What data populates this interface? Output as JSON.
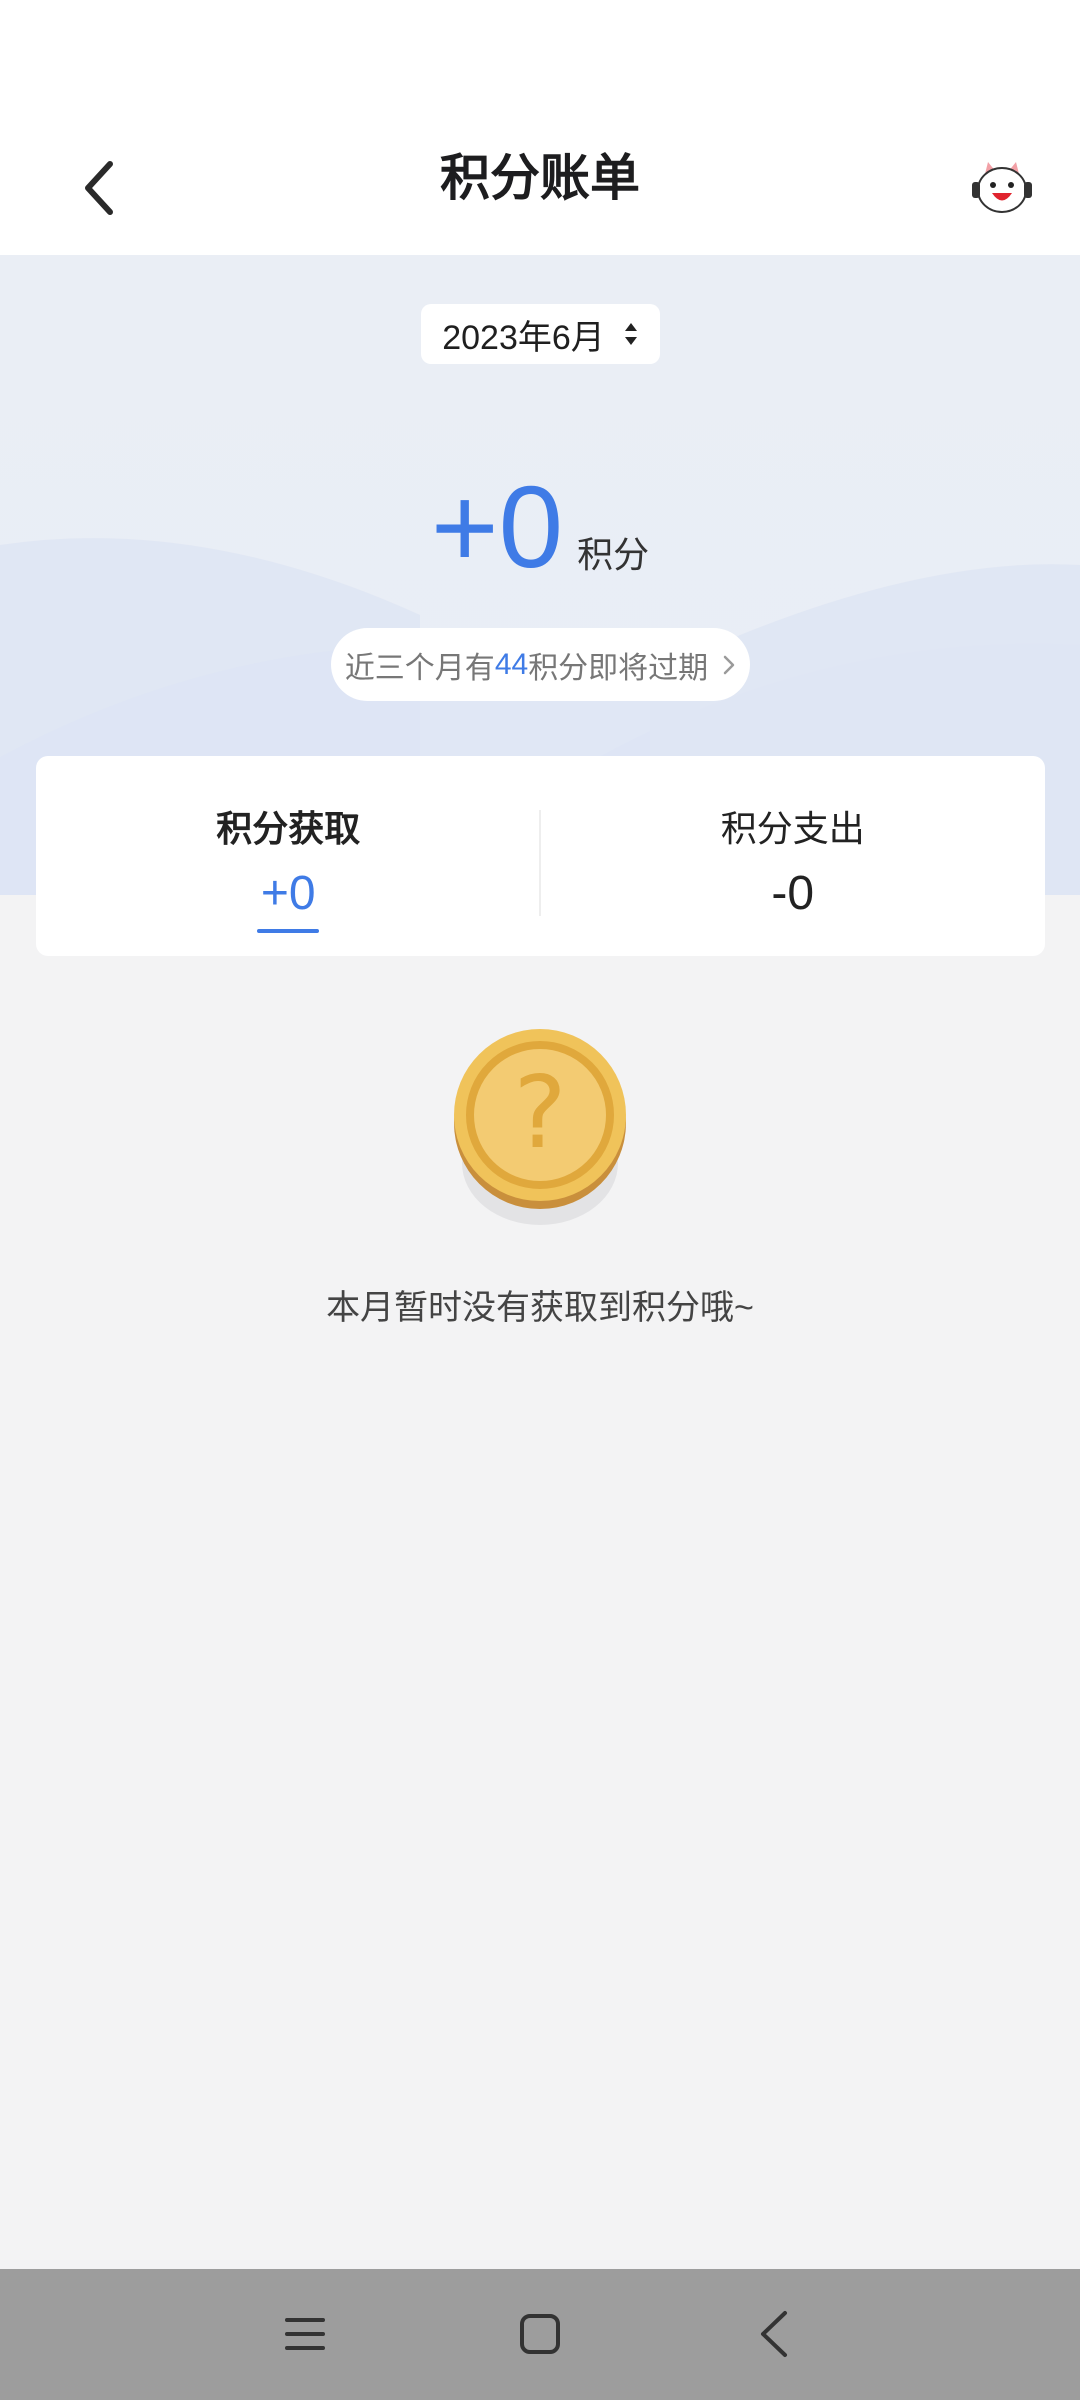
{
  "header": {
    "title": "积分账单",
    "back_icon": "chevron-left-icon",
    "mascot_icon": "mascot-avatar-icon"
  },
  "month_picker": {
    "value": "2023年6月",
    "icon": "sort-arrows-icon"
  },
  "points": {
    "value": "+0",
    "unit": "积分"
  },
  "expire_notice": {
    "prefix": "近三个月有",
    "number": "44",
    "suffix": "积分即将过期",
    "icon": "chevron-right-icon"
  },
  "summary": {
    "earned_label": "积分获取",
    "earned_value": "+0",
    "spent_label": "积分支出",
    "spent_value": "-0"
  },
  "empty_state": {
    "icon": "question-coin-icon",
    "message": "本月暂时没有获取到积分哦~"
  },
  "nav_bar": {
    "menu_icon": "menu-icon",
    "home_icon": "home-square-icon",
    "back_icon": "back-triangle-icon"
  },
  "colors": {
    "accent": "#3f7be6",
    "background": "#f3f3f4",
    "coin": "#f0c35a"
  }
}
